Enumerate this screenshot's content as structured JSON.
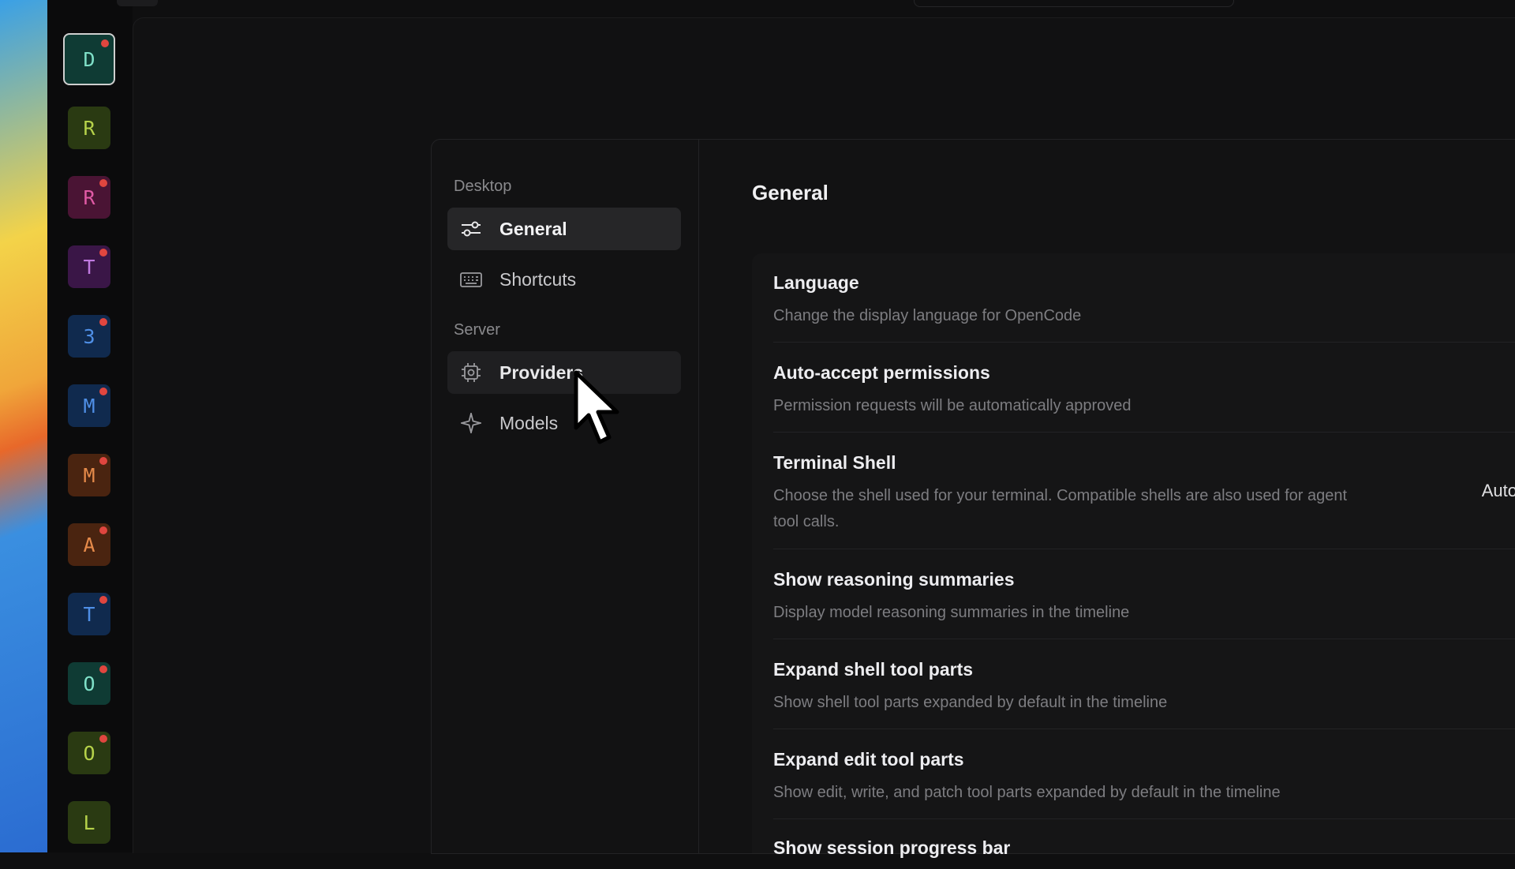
{
  "workspaces": [
    {
      "letter": "D",
      "bg": "#0f3b34",
      "fg": "#7fe0c8",
      "dot": true,
      "active": true
    },
    {
      "letter": "R",
      "bg": "#2a3a12",
      "fg": "#b6d24a",
      "dot": false,
      "active": false
    },
    {
      "letter": "R",
      "bg": "#4a1434",
      "fg": "#e05aa5",
      "dot": true,
      "active": false
    },
    {
      "letter": "T",
      "bg": "#3a1647",
      "fg": "#c07ae0",
      "dot": true,
      "active": false
    },
    {
      "letter": "3",
      "bg": "#102a4e",
      "fg": "#4f8fe6",
      "dot": true,
      "active": false
    },
    {
      "letter": "M",
      "bg": "#102a4e",
      "fg": "#4f8fe6",
      "dot": true,
      "active": false
    },
    {
      "letter": "M",
      "bg": "#4a2410",
      "fg": "#e58a4a",
      "dot": true,
      "active": false
    },
    {
      "letter": "A",
      "bg": "#4a2410",
      "fg": "#e58a4a",
      "dot": true,
      "active": false
    },
    {
      "letter": "T",
      "bg": "#102a4e",
      "fg": "#4f8fe6",
      "dot": true,
      "active": false
    },
    {
      "letter": "O",
      "bg": "#0f3b34",
      "fg": "#7fe0c8",
      "dot": true,
      "active": false
    },
    {
      "letter": "O",
      "bg": "#2a3a12",
      "fg": "#b6d24a",
      "dot": true,
      "active": false
    },
    {
      "letter": "L",
      "bg": "#2a3a12",
      "fg": "#b6d24a",
      "dot": false,
      "active": false
    }
  ],
  "nav": {
    "section_desktop": "Desktop",
    "section_server": "Server",
    "general": "General",
    "shortcuts": "Shortcuts",
    "providers": "Providers",
    "models": "Models"
  },
  "content": {
    "title": "General",
    "rows": [
      {
        "title": "Language",
        "desc": "Change the display language for OpenCode",
        "value": ""
      },
      {
        "title": "Auto-accept permissions",
        "desc": "Permission requests will be automatically approved",
        "value": ""
      },
      {
        "title": "Terminal Shell",
        "desc": "Choose the shell used for your terminal. Compatible shells are also used for agent tool calls.",
        "value": "Auto"
      },
      {
        "title": "Show reasoning summaries",
        "desc": "Display model reasoning summaries in the timeline",
        "value": ""
      },
      {
        "title": "Expand shell tool parts",
        "desc": "Show shell tool parts expanded by default in the timeline",
        "value": ""
      },
      {
        "title": "Expand edit tool parts",
        "desc": "Show edit, write, and patch tool parts expanded by default in the timeline",
        "value": ""
      },
      {
        "title": "Show session progress bar",
        "desc": "",
        "value": ""
      }
    ]
  }
}
